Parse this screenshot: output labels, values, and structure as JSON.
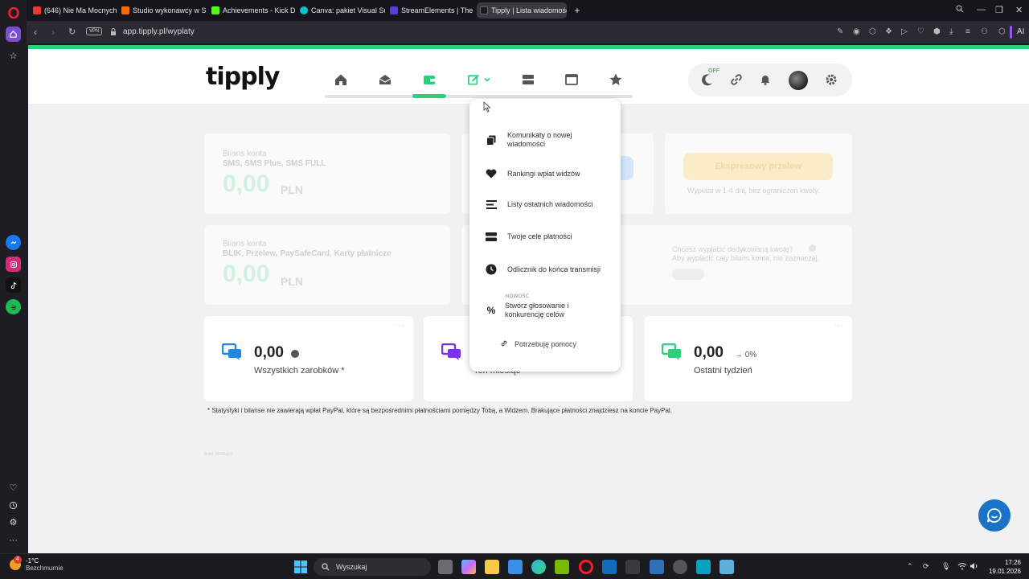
{
  "browser": {
    "tabs": [
      {
        "label": "(646) Nie Ma Mocnych Na",
        "color": "#e53935"
      },
      {
        "label": "Studio wykonawcy w Sou",
        "color": "#ff6a00"
      },
      {
        "label": "Achievements - Kick Dash",
        "color": "#53fc18"
      },
      {
        "label": "Canva: pakiet Visual Suite",
        "color": "#00c4cc"
      },
      {
        "label": "StreamElements | The Ulti",
        "color": "#5b3dd6"
      },
      {
        "label": "Tipply | Lista wiadomości",
        "color": "#1a1a1a"
      }
    ],
    "url": "app.tipply.pl/wyplaty",
    "vpn_label": "VPN",
    "ai_label": "AI"
  },
  "site": {
    "logo": "tipply",
    "theme_toggle_badge": "OFF"
  },
  "cards": {
    "balance1_title": "Bilans konta",
    "balance1_sub": "SMS, SMS Plus, SMS FULL",
    "balance1_value": "0,00",
    "balance1_currency": "PLN",
    "balance2_title": "Bilans konta",
    "balance2_sub": "BLIK, Przelew, PaySafeCard, Karty płatnicze",
    "balance2_value": "0,00",
    "balance2_currency": "PLN",
    "express_button": "Ekspresowy przelew",
    "express_note": "Wypłata w 1-4 dni, bez ograniczeń kwoty.",
    "custom_q1": "Chcesz wypłacić dedykowaną kwotę?",
    "custom_q2": "Aby wypłacić cały bilans konta, nie zaznaczaj."
  },
  "stats": [
    {
      "value": "0,00",
      "suffix": "",
      "label": "Wszystkich zarobków *",
      "icon_color": "#1e88e5"
    },
    {
      "value": "",
      "suffix": "",
      "label": "Ten miesiąc",
      "icon_color": "#7b2ff7"
    },
    {
      "value": "0,00",
      "suffix": "→ 0%",
      "label": "Ostatni tydzień",
      "icon_color": "#2ecf7a"
    }
  ],
  "footnote": "* Statystyki i bilanse nie zawierają wpłat PayPal, które są bezpośrednimi płatnościami pomiędzy Tobą, a Widzem. Brakujące płatności znajdziesz na koncie PayPal.",
  "build": "Build: 9e0f9ab9",
  "dropdown": {
    "items": [
      {
        "label": "Komunikaty o nowej wiadomości"
      },
      {
        "label": "Rankingi wpłat widzów"
      },
      {
        "label": "Listy ostatnich wiadomości"
      },
      {
        "label": "Twoje cele płatności"
      },
      {
        "label": "Odlicznik do końca transmisji"
      },
      {
        "label": "Stwórz głosowanie i konkurencję celów"
      }
    ],
    "new_badge": "NOWOŚĆ",
    "help": "Potrzebuję pomocy"
  },
  "taskbar": {
    "weather_temp": "-1°C",
    "weather_desc": "Bezchmurnie",
    "weather_badge": "4",
    "search_placeholder": "Wyszukaj",
    "time": "17:26",
    "date": "19.01.2026"
  }
}
